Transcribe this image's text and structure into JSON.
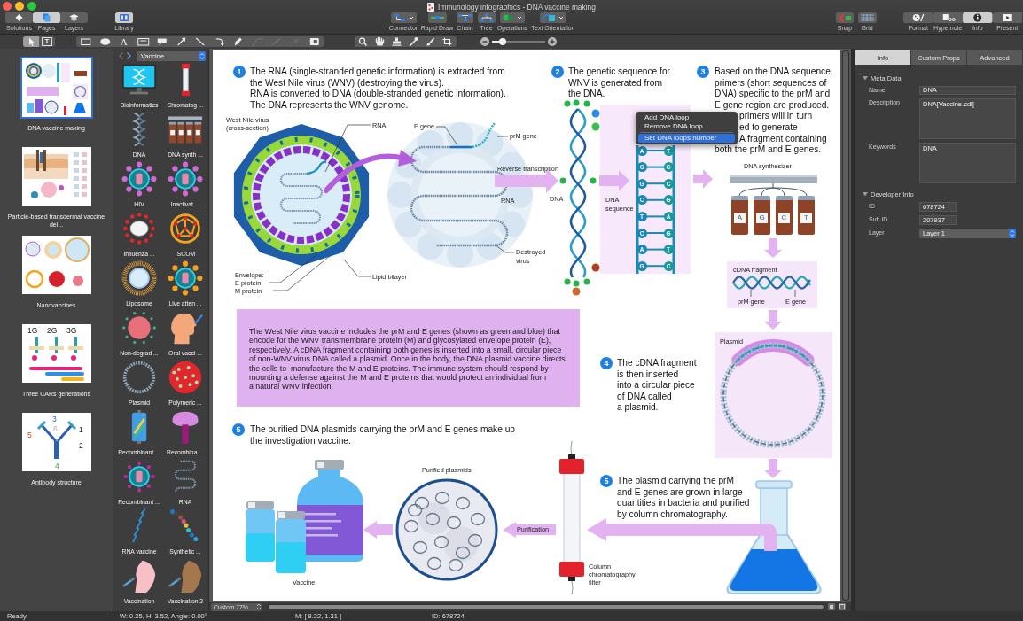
{
  "window": {
    "title": "Immunology infographics - DNA vaccine making"
  },
  "toolbar": {
    "panels": [
      {
        "label": "Solutions",
        "kind": "solutions",
        "selected": false
      },
      {
        "label": "Pages",
        "kind": "pages",
        "selected": true
      },
      {
        "label": "Layers",
        "kind": "layers",
        "selected": false
      }
    ],
    "library": {
      "label": "Library",
      "kind": "library",
      "selected": true
    },
    "tools": [
      {
        "label": "Connector",
        "kind": "connector"
      },
      {
        "label": "Rapid Draw",
        "kind": "rapid-draw"
      },
      {
        "label": "Chain",
        "kind": "chain"
      },
      {
        "label": "Tree",
        "kind": "tree"
      },
      {
        "label": "Operations",
        "kind": "operations"
      },
      {
        "label": "Text Orientation",
        "kind": "text-orientation"
      }
    ],
    "assists": [
      {
        "label": "Snap",
        "kind": "snap"
      },
      {
        "label": "Grid",
        "kind": "grid"
      }
    ],
    "views": [
      {
        "label": "Format",
        "kind": "format",
        "selected": false
      },
      {
        "label": "Hypernote",
        "kind": "hypernote",
        "selected": false
      },
      {
        "label": "Info",
        "kind": "info",
        "selected": true
      },
      {
        "label": "Present",
        "kind": "present",
        "selected": false
      }
    ]
  },
  "drawing_toolbar": {
    "select_tools": [
      {
        "kind": "pointer",
        "selected": true
      },
      {
        "kind": "text-frame",
        "glyph": "T",
        "selected": false
      }
    ],
    "shape_tools": [
      {
        "kind": "rectangle",
        "disabled": false
      },
      {
        "kind": "ellipse",
        "disabled": false
      },
      {
        "kind": "text",
        "glyph": "A",
        "disabled": false
      },
      {
        "kind": "text-box",
        "disabled": false
      },
      {
        "kind": "callout",
        "disabled": false
      },
      {
        "kind": "arrow",
        "disabled": false
      },
      {
        "kind": "line",
        "disabled": false
      },
      {
        "kind": "arc",
        "disabled": false
      },
      {
        "kind": "pen",
        "disabled": false
      },
      {
        "kind": "bezier",
        "disabled": true
      },
      {
        "kind": "spline",
        "disabled": true
      },
      {
        "kind": "cut",
        "disabled": true
      },
      {
        "kind": "image",
        "disabled": false
      }
    ],
    "view_tools": [
      {
        "kind": "search"
      },
      {
        "kind": "hand"
      },
      {
        "kind": "stamp"
      },
      {
        "kind": "eyedropper"
      },
      {
        "kind": "brush"
      },
      {
        "kind": "crop"
      }
    ],
    "zoom_slider": {
      "level": 0.2
    }
  },
  "pages": [
    {
      "title": "DNA vaccine making",
      "kind": "infographic",
      "selected": true
    },
    {
      "title": "Particle-based transdermal vaccine del...",
      "kind": "skin",
      "selected": false
    },
    {
      "title": "Nanovaccines",
      "kind": "particles",
      "selected": false
    },
    {
      "title": "Three CARs generations",
      "kind": "cars",
      "selected": false,
      "thumbnail_labels": [
        "1G",
        "2G",
        "3G"
      ]
    },
    {
      "title": "Antibody structure",
      "kind": "antibody",
      "selected": false,
      "thumbnail_labels": [
        "3",
        "6",
        "1",
        "2",
        "5",
        "4"
      ]
    }
  ],
  "library": {
    "category": "Vaccine",
    "items": [
      {
        "label": "Bioinformatics",
        "kind": "monitor"
      },
      {
        "label": "Chromatog ...",
        "kind": "column"
      },
      {
        "label": "DNA",
        "kind": "helix"
      },
      {
        "label": "DNA synth ...",
        "kind": "synthesizer"
      },
      {
        "label": "HIV",
        "kind": "virus"
      },
      {
        "label": "Inactivat ...",
        "kind": "virus"
      },
      {
        "label": "Influenza ...",
        "kind": "influenza"
      },
      {
        "label": "ISCOM",
        "kind": "cage"
      },
      {
        "label": "Liposome",
        "kind": "liposome"
      },
      {
        "label": "Live atten ...",
        "kind": "virus-dots"
      },
      {
        "label": "Non-degrad ...",
        "kind": "spiky-sphere"
      },
      {
        "label": "Oral vacci ...",
        "kind": "head"
      },
      {
        "label": "Plasmid",
        "kind": "ring"
      },
      {
        "label": "Polymeric ...",
        "kind": "polymer"
      },
      {
        "label": "Recombinant ...",
        "kind": "device"
      },
      {
        "label": "Recombina ...",
        "kind": "mushroom"
      },
      {
        "label": "Recombinant ...",
        "kind": "virus-spikes"
      },
      {
        "label": "RNA",
        "kind": "rna"
      },
      {
        "label": "RNA vaccine",
        "kind": "strand"
      },
      {
        "label": "Synthetic ...",
        "kind": "beads"
      },
      {
        "label": "Vaccination",
        "kind": "arm"
      },
      {
        "label": "Vaccination 2",
        "kind": "arm-dark"
      }
    ]
  },
  "canvas": {
    "steps": [
      {
        "number": "1",
        "text": "The RNA (single-stranded genetic information) is extracted from\nthe West Nile virus (WNV) (destroying the virus).\nRNA is converted to DNA (double-stranded genetic information).\nThe DNA represents the WNV genome."
      },
      {
        "number": "2",
        "text": "The genetic sequence for\nWNV is generated from\nthe DNA."
      },
      {
        "number": "3",
        "text": "Based on the DNA sequence,\nprimers (short sequences of\nDNA) specific to the prM and\nE gene region are produced.",
        "menu_covered_text": "primers will in turn\ned to generate\nA fragment containing",
        "closing_text": "both the prM and E genes."
      },
      {
        "number": "4",
        "text": "The cDNA fragment\nis then inserted\ninto a circular piece\nof DNA called\na plasmid."
      },
      {
        "number": "5",
        "text": "The purified DNA plasmids carrying the prM and E genes make up\nthe investigation vaccine."
      },
      {
        "number": "5",
        "text": "The plasmid carrying the prM\nand E genes are grown in large\nquantities in bacteria and purified\nby column chromatography."
      }
    ],
    "note": "The West Nile virus vaccine includes the prM and E genes (shown as green and blue) that\nencode for the WNV transmembrane protein (M) and glycosylated envelope protein (E),\nrespectively. A cDNA fragment containing both genes is inserted into a small, circular piece\nof non-WNV virus DNA called a plasmid. Once in the body, the DNA plasmid vaccine directs\nthe cells to  manufacture the M and E proteins. The immune system should respond by\nmounting a defense against the M and E proteins that would protect an individual from\na natural WNV infection.",
    "virus": {
      "title": "West Nile virus\n(cross-section)",
      "rna_label": "RNA",
      "envelope_label": "Envelope:\nE protein\nM protein",
      "bilayer_label": "Lipid bilayer"
    },
    "destroyed_virus": {
      "e_gene_label": "E gene",
      "prm_gene_label": "prM gene",
      "rna_label": "RNA",
      "caption": "Destroyed\nvirus"
    },
    "transcription_label": "Reverse transcription",
    "dna": {
      "label": "DNA",
      "selected": true
    },
    "sequence": {
      "label": "DNA\nsequence",
      "pairs": [
        [
          "A",
          "T"
        ],
        [
          "C",
          "G"
        ],
        [
          "G",
          "C"
        ],
        [
          "C",
          "G"
        ],
        [
          "T",
          "A"
        ],
        [
          "C",
          "G"
        ],
        [
          "A",
          "T"
        ],
        [
          "G",
          "C"
        ]
      ]
    },
    "context_menu": [
      [
        {
          "label": "Add DNA loop",
          "selected": false
        },
        {
          "label": "Remove DNA loop",
          "selected": false
        }
      ],
      [
        {
          "label": "Set DNA loops number",
          "selected": true
        }
      ]
    ],
    "synthesizer": {
      "title": "DNA synthesizer",
      "vials": [
        "A",
        "G",
        "C",
        "T"
      ]
    },
    "cdna": {
      "title": "cDNA fragment",
      "prm_label": "prM gene",
      "e_label": "E gene"
    },
    "plasmid": {
      "title": "Plasmid"
    },
    "purified": {
      "title": "Purified plasmids"
    },
    "purification_label": "Purification",
    "column_label": "Column\nchromatography\nfilter",
    "vaccine_label": "Vaccine"
  },
  "inspector": {
    "tabs": [
      {
        "label": "Info",
        "selected": true
      },
      {
        "label": "Custom Props",
        "selected": false
      },
      {
        "label": "Advanced",
        "selected": false
      }
    ],
    "sections": [
      {
        "title": "Meta Data",
        "expanded": true,
        "fields": [
          {
            "label": "Name",
            "value": "DNA",
            "kind": "text"
          },
          {
            "label": "Description",
            "value": "DNA[Vaccine.cdl]",
            "kind": "area"
          },
          {
            "label": "Keywords",
            "value": "DNA",
            "kind": "area"
          }
        ]
      },
      {
        "title": "Developer Info",
        "expanded": true,
        "fields": [
          {
            "label": "ID",
            "value": "678724",
            "kind": "short"
          },
          {
            "label": "Sub ID",
            "value": "207937",
            "kind": "short"
          },
          {
            "label": "Layer",
            "value": "Layer 1",
            "kind": "select"
          }
        ]
      }
    ]
  },
  "canvas_footer": {
    "zoom": "Custom 77%"
  },
  "status_bar": {
    "state": "Ready",
    "size": "W: 0.25, H: 3.52, Angle: 0.00°",
    "mouse": "M: [ 8.22, 1.31 ]",
    "id": "ID: 678724"
  }
}
